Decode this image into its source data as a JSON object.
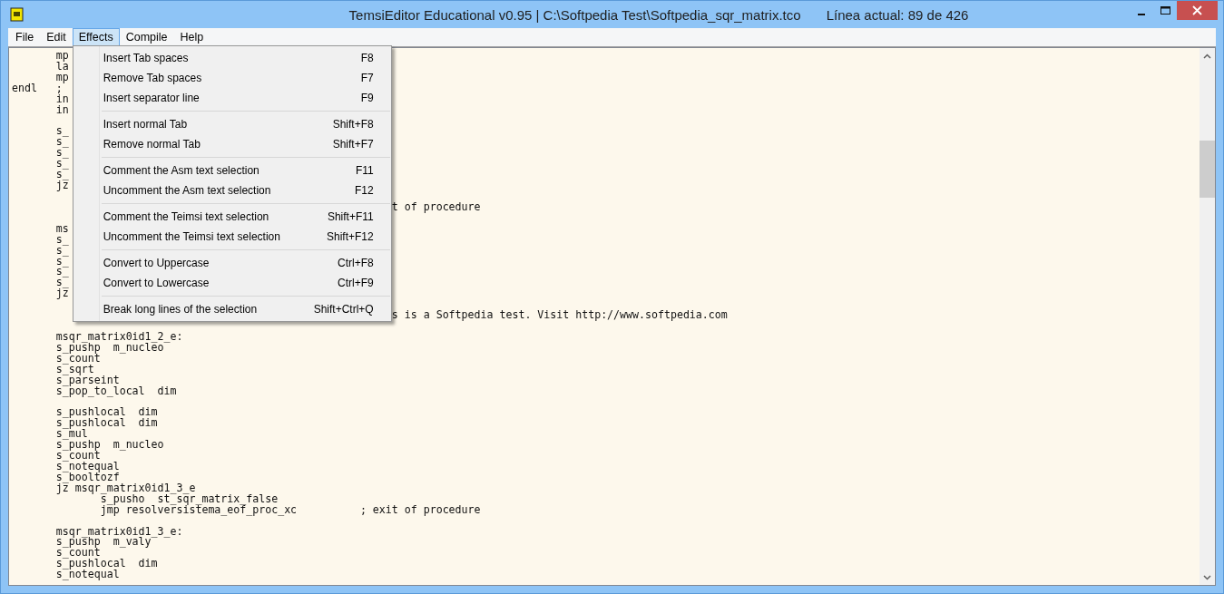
{
  "window": {
    "title": "TemsiEditor Educational v0.95 | C:\\Softpedia Test\\Softpedia_sqr_matrix.tco",
    "current_line": "Línea actual: 89 de 426"
  },
  "menubar": [
    {
      "label": "File",
      "selected": false
    },
    {
      "label": "Edit",
      "selected": false
    },
    {
      "label": "Effects",
      "selected": true
    },
    {
      "label": "Compile",
      "selected": false
    },
    {
      "label": "Help",
      "selected": false
    }
  ],
  "dropdown": [
    [
      {
        "label": "Insert Tab spaces",
        "shortcut": "F8"
      },
      {
        "label": "Remove Tab spaces",
        "shortcut": "F7"
      },
      {
        "label": "Insert separator line",
        "shortcut": "F9"
      }
    ],
    [
      {
        "label": "Insert normal Tab",
        "shortcut": "Shift+F8"
      },
      {
        "label": "Remove normal Tab",
        "shortcut": "Shift+F7"
      }
    ],
    [
      {
        "label": "Comment the Asm text selection",
        "shortcut": "F11"
      },
      {
        "label": "Uncomment the Asm text selection",
        "shortcut": "F12"
      }
    ],
    [
      {
        "label": "Comment the Teimsi text selection",
        "shortcut": "Shift+F11"
      },
      {
        "label": "Uncomment the Teimsi text selection",
        "shortcut": "Shift+F12"
      }
    ],
    [
      {
        "label": "Convert to Uppercase",
        "shortcut": "Ctrl+F8"
      },
      {
        "label": "Convert to Lowercase",
        "shortcut": "Ctrl+F9"
      }
    ],
    [
      {
        "label": "Break long lines of the selection",
        "shortcut": "Shift+Ctrl+Q"
      }
    ]
  ],
  "editor": {
    "lines": [
      {
        "kind": "code",
        "text": "       mp"
      },
      {
        "kind": "code",
        "text": "       la"
      },
      {
        "kind": "code",
        "text": "       mp"
      },
      {
        "kind": "code",
        "text": "endl   ;"
      },
      {
        "kind": "code",
        "text": "       in"
      },
      {
        "kind": "code",
        "text": "       in"
      },
      {
        "kind": "blank"
      },
      {
        "kind": "code",
        "text": "       s_"
      },
      {
        "kind": "code",
        "text": "       s_"
      },
      {
        "kind": "code",
        "text": "       s_"
      },
      {
        "kind": "code",
        "text": "       s_"
      },
      {
        "kind": "code",
        "text": "       s_"
      },
      {
        "kind": "code",
        "text": "       jz"
      },
      {
        "kind": "blank"
      },
      {
        "kind": "code",
        "tail": "t of procedure"
      },
      {
        "kind": "blank"
      },
      {
        "kind": "code",
        "text": "       ms"
      },
      {
        "kind": "code",
        "text": "       s_"
      },
      {
        "kind": "code",
        "text": "       s_"
      },
      {
        "kind": "code",
        "text": "       s_"
      },
      {
        "kind": "code",
        "text": "       s_"
      },
      {
        "kind": "code",
        "text": "       s_"
      },
      {
        "kind": "code",
        "text": "       jz"
      },
      {
        "kind": "blank"
      },
      {
        "kind": "code",
        "tail": "s is a Softpedia test. Visit http://www.softpedia.com"
      },
      {
        "kind": "blank"
      },
      {
        "kind": "code",
        "text": "       msqr_matrix0id1_2_e:"
      },
      {
        "kind": "code",
        "text": "       s_pushp  m_nucleo"
      },
      {
        "kind": "code",
        "text": "       s_count"
      },
      {
        "kind": "code",
        "text": "       s_sqrt"
      },
      {
        "kind": "code",
        "text": "       s_parseint"
      },
      {
        "kind": "code",
        "text": "       s_pop_to_local  dim"
      },
      {
        "kind": "blank"
      },
      {
        "kind": "code",
        "text": "       s_pushlocal  dim"
      },
      {
        "kind": "code",
        "text": "       s_pushlocal  dim"
      },
      {
        "kind": "code",
        "text": "       s_mul"
      },
      {
        "kind": "code",
        "text": "       s_pushp  m_nucleo"
      },
      {
        "kind": "code",
        "text": "       s_count"
      },
      {
        "kind": "code",
        "text": "       s_notequal"
      },
      {
        "kind": "code",
        "text": "       s_booltozf"
      },
      {
        "kind": "code",
        "text": "       jz msqr_matrix0id1_3_e"
      },
      {
        "kind": "code",
        "text": "              s_pusho  st_sqr_matrix_false"
      },
      {
        "kind": "code",
        "text": "              jmp resolversistema_eof_proc_xc          ; exit of procedure"
      },
      {
        "kind": "blank"
      },
      {
        "kind": "code",
        "text": "       msqr_matrix0id1_3_e:"
      },
      {
        "kind": "code",
        "text": "       s_pushp  m_valy"
      },
      {
        "kind": "code",
        "text": "       s_count"
      },
      {
        "kind": "code",
        "text": "       s_pushlocal  dim"
      },
      {
        "kind": "code",
        "text": "       s_notequal"
      }
    ]
  }
}
